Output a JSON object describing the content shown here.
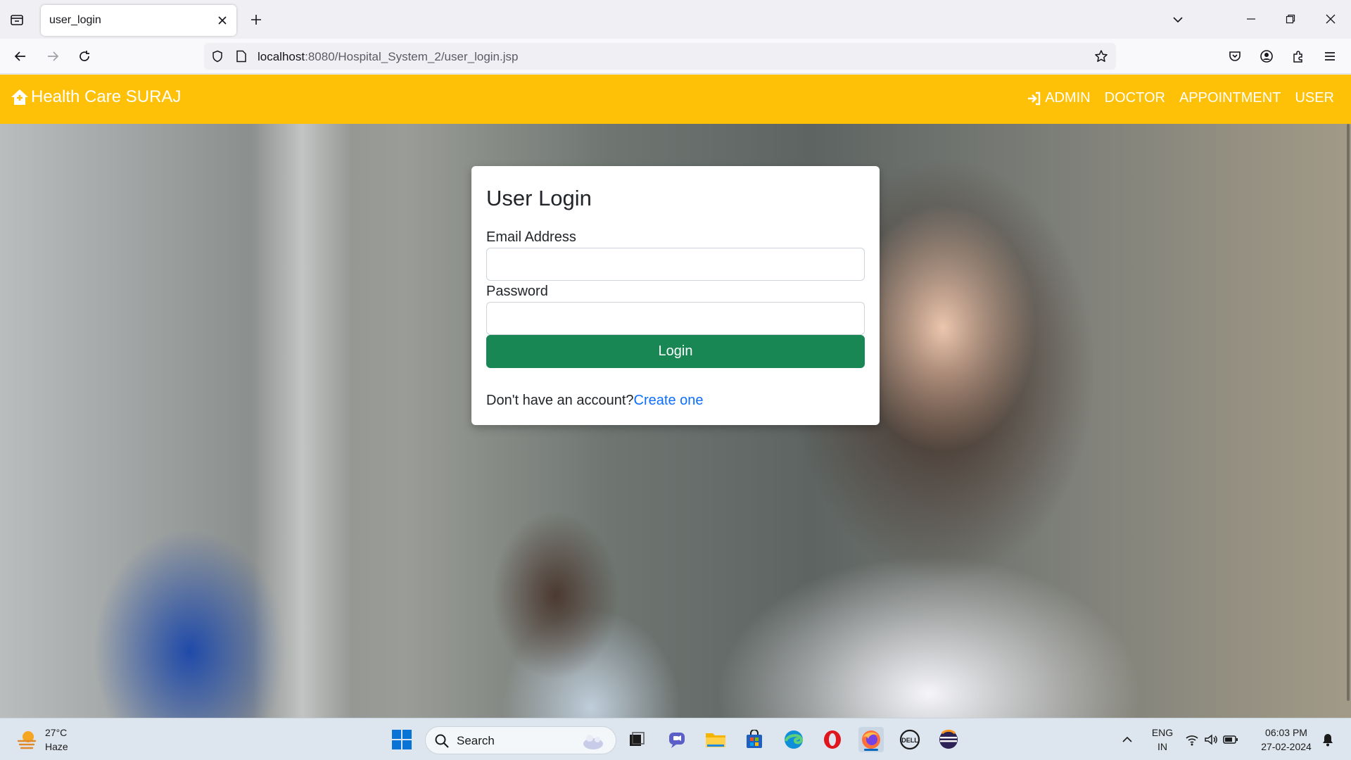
{
  "browser": {
    "tab_title": "user_login",
    "url_host": "localhost",
    "url_path": ":8080/Hospital_System_2/user_login.jsp"
  },
  "header": {
    "brand": "Health Care SURAJ",
    "nav": {
      "admin": "ADMIN",
      "doctor": "DOCTOR",
      "appointment": "APPOINTMENT",
      "user": "USER"
    }
  },
  "login_card": {
    "title": "User Login",
    "email_label": "Email Address",
    "email_value": "",
    "password_label": "Password",
    "password_value": "",
    "button_label": "Login",
    "signup_prompt": "Don't have an account?",
    "signup_link": "Create one"
  },
  "taskbar": {
    "weather_temp": "27°C",
    "weather_desc": "Haze",
    "search_placeholder": "Search",
    "lang_line1": "ENG",
    "lang_line2": "IN",
    "time": "06:03 PM",
    "date": "27-02-2024"
  },
  "colors": {
    "header": "#ffc107",
    "login_button": "#198754",
    "link": "#0d6efd"
  },
  "icons": {
    "brand": "house-icon",
    "admin": "sign-in-icon"
  }
}
